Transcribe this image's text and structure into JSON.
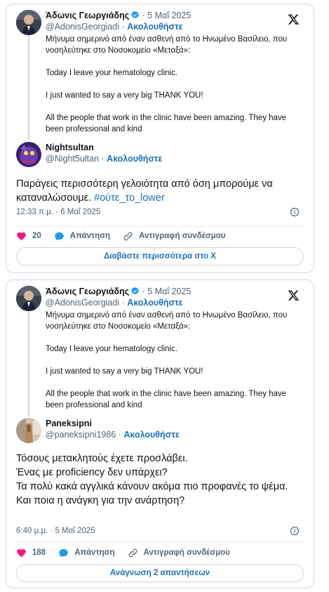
{
  "cards": [
    {
      "quoted": {
        "name": "Άδωνις Γεωργιάδης",
        "date": "5 Μαΐ 2025",
        "handle": "@AdonisGeorgiadi",
        "follow": "Ακολουθήστε",
        "paragraphs": [
          "Μήνυμα σημερινό από έναν ασθενή από το Ηνωμένο Βασίλειο, που νοσηλεύτηκε στο Νοσοκομείο «Μεταξά»:",
          "Today I leave your hematology clinic.",
          "I just wanted to say a very big THANK YOU!",
          "All the people that work in the clinic have been amazing. They have been professional and kind"
        ]
      },
      "reply": {
        "name": "Nightsultan",
        "handle": "@Night5ultan",
        "follow": "Ακολουθήστε",
        "text": "Παράγεις περισσότερη γελοιότητα από όση μπορούμε να καταναλώσουμε. ",
        "hashtag": "#ούτε_το_lower",
        "time": "12:33 π.μ. · 6 Μαΐ 2025"
      },
      "actions": {
        "likes": "20",
        "reply": "Απάντηση",
        "copy": "Αντιγραφή συνδέσμου"
      },
      "cta": "Διαβάστε περισσότερα στο Χ"
    },
    {
      "quoted": {
        "name": "Άδωνις Γεωργιάδης",
        "date": "5 Μαΐ 2025",
        "handle": "@AdonisGeorgiadi",
        "follow": "Ακολουθήστε",
        "paragraphs": [
          "Μήνυμα σημερινό από έναν ασθενή από το Ηνωμένο Βασίλειο, που νοσηλεύτηκε στο Νοσοκομείο «Μεταξά»:",
          "Today I leave your hematology clinic.",
          "I just wanted to say a very big THANK YOU!",
          "All the people that work in the clinic have been amazing. They have been professional and kind"
        ]
      },
      "reply": {
        "name": "Paneksipni",
        "handle": "@paneksipni1986",
        "follow": "Ακολουθήστε",
        "lines": [
          "Τόσους μετακλητούς έχετε προσλάβει.",
          "Ένας με proficiency δεν υπάρχει?",
          "Τα πολύ κακά αγγλικά κάνουν ακόμα πιο προφανές το ψέμα.",
          "Και ποια η ανάγκη για την ανάρτηση?"
        ],
        "time": "6:40 μ.μ. · 5 Μαΐ 2025"
      },
      "actions": {
        "likes": "188",
        "reply": "Απάντηση",
        "copy": "Αντιγραφή συνδέσμου"
      },
      "cta": "Ανάγνωση 2 απαντήσεων"
    }
  ],
  "colors": {
    "accent": "#1d6fb8",
    "verified": "#1d9bf0",
    "like": "#f91880",
    "muted": "#536471",
    "border": "#cfd9de"
  },
  "icons": {
    "brand": "x-logo-icon",
    "verified": "verified-badge-icon",
    "like": "heart-icon",
    "reply": "speech-bubble-icon",
    "copy": "link-icon",
    "info": "info-icon"
  }
}
